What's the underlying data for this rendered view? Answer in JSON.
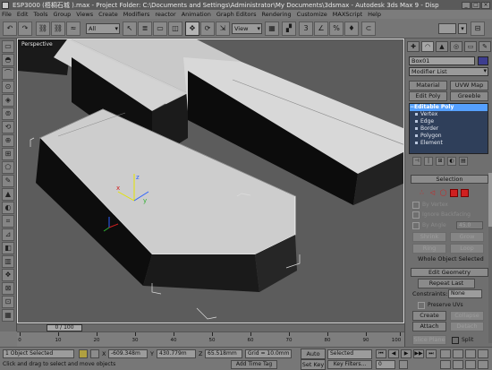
{
  "window": {
    "title": "ESP3000 (梧桐石城 ).max - Project Folder: C:\\Documents and Settings\\Administrator\\My Documents\\3dsmax - Autodesk 3ds Max 9 - Disp",
    "min_label": "_",
    "max_label": "□",
    "close_label": "×"
  },
  "menu": [
    "File",
    "Edit",
    "Tools",
    "Group",
    "Views",
    "Create",
    "Modifiers",
    "reactor",
    "Animation",
    "Graph Editors",
    "Rendering",
    "Customize",
    "MAXScript",
    "Help"
  ],
  "toolbar": {
    "undo": "↶",
    "redo": "↷",
    "link": "⛓",
    "unlink": "⛓",
    "bind": "≈",
    "filter_value": "All",
    "select": "↖",
    "select_by_name": "≣",
    "region": "▭",
    "window_crossing": "◫",
    "move": "✥",
    "rotate": "⟳",
    "scale": "⇲",
    "refcoord_value": "View",
    "pivot": "▦",
    "select_manip": "▞",
    "snap3d": "3",
    "angle_snap": "∠",
    "percent_snap": "%",
    "spinner_snap": "♦",
    "named_sel_label": "⊂",
    "named_sel_drop": "▾",
    "mirror": "⊟",
    "align": "≡"
  },
  "left_tools": [
    "▭",
    "◓",
    "⌒",
    "⊙",
    "◈",
    "⊚",
    "⟲",
    "⊕",
    "⊞",
    "⬠",
    "✎",
    "▲",
    "◐",
    "⌗",
    "⊿",
    "◧",
    "▥",
    "❖",
    "⊠",
    "⊡",
    "▦",
    "◍"
  ],
  "viewport": {
    "label": "Perspective",
    "gizmo_xyz": [
      "x",
      "y",
      "z"
    ]
  },
  "timeline": {
    "frame_label": "0 / 100",
    "ticks": [
      "0",
      "10",
      "20",
      "30",
      "40",
      "50",
      "60",
      "70",
      "80",
      "90",
      "100"
    ]
  },
  "status": {
    "selection": "1 Object Selected",
    "prompt": "Click and drag to select and move objects",
    "x_label": "X",
    "x_value": "-609.348m",
    "y_label": "Y",
    "y_value": "430.779m",
    "z_label": "Z",
    "z_value": "65.518mm",
    "grid": "Grid = 10.0mm",
    "add_time_tag": "Add Time Tag",
    "auto_key": "Auto Key",
    "set_key": "Set Key",
    "key_selected": "Selected",
    "key_filters": "Key Filters...",
    "playback": [
      "⏮",
      "◀",
      "▶",
      "▶▶",
      "⏭"
    ],
    "frame_value": "0"
  },
  "command_panel": {
    "tabs": [
      "✚",
      "◠",
      "▲",
      "◎",
      "▭",
      "✎"
    ],
    "object_name": "Box01",
    "object_color": "#3d3d8f",
    "modifier_list": "Modifier List",
    "quick_buttons": [
      "Material",
      "UVW Map",
      "Edit Poly",
      "Greeble"
    ],
    "stack": {
      "base": "Editable Poly",
      "subs": [
        "Vertex",
        "Edge",
        "Border",
        "Polygon",
        "Element"
      ]
    },
    "stack_tools": [
      "⊣",
      "|",
      "⊞",
      "◐",
      "▤"
    ],
    "selection": {
      "title": "Selection",
      "sub_icons": [
        "∴",
        "◁",
        "◯",
        "■",
        "■"
      ],
      "by_vertex": "By Vertex",
      "ignore_backfacing": "Ignore Backfacing",
      "by_angle": "By Angle",
      "angle_value": "45.0",
      "shrink": "Shrink",
      "grow": "Grow",
      "ring": "Ring",
      "loop": "Loop",
      "summary": "Whole Object Selected"
    },
    "edit_geometry": {
      "title": "Edit Geometry",
      "repeat_last": "Repeat Last",
      "constraints_label": "Constraints:",
      "constraints_value": "None",
      "preserve_uvs": "Preserve UVs",
      "create": "Create",
      "collapse": "Collapse",
      "attach": "Attach",
      "detach": "Detach",
      "slice_plane": "Slice Plane",
      "split": "Split"
    }
  },
  "colors": {
    "viewport_bg": "#5c5c5c",
    "ui_gray": "#7a7a7a",
    "selection_red": "#d02020",
    "stack_blue": "#2f3f5a"
  }
}
